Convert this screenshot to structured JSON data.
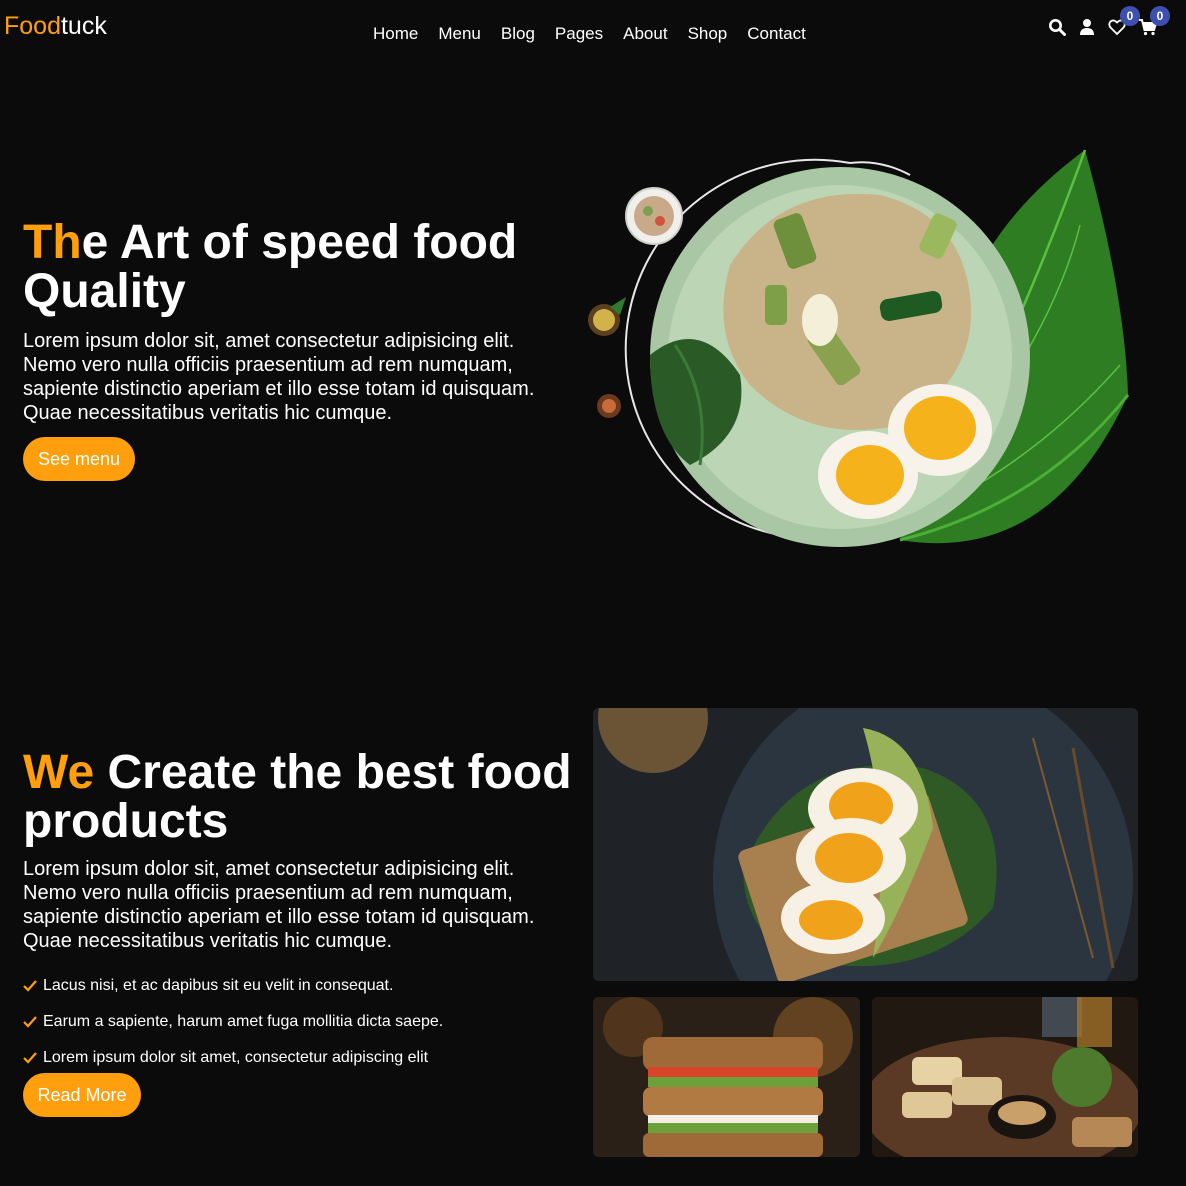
{
  "header": {
    "logo": {
      "part1": "Food",
      "part2": "tuck"
    },
    "nav": [
      "Home",
      "Menu",
      "Blog",
      "Pages",
      "About",
      "Shop",
      "Contact"
    ],
    "wishlist_count": "0",
    "cart_count": "0"
  },
  "hero": {
    "title_accent": "Th",
    "title_rest": "e Art of speed food Quality",
    "paragraph": "Lorem ipsum dolor sit, amet consectetur adipisicing elit. Nemo vero nulla officiis praesentium ad rem numquam, sapiente distinctio aperiam et illo esse totam id quisquam. Quae necessitatibus veritatis hic cumque.",
    "button": "See menu"
  },
  "about": {
    "title_accent": "We",
    "title_rest": " Create the best food products",
    "paragraph": "Lorem ipsum dolor sit, amet consectetur adipisicing elit. Nemo vero nulla officiis praesentium ad rem numquam, sapiente distinctio aperiam et illo esse totam id quisquam. Quae necessitatibus veritatis hic cumque.",
    "checklist": [
      "Lacus nisi, et ac dapibus sit eu velit in consequat.",
      "Earum a sapiente, harum amet fuga mollitia dicta saepe.",
      "Lorem ipsum dolor sit amet, consectetur adipiscing elit"
    ],
    "button": "Read More"
  },
  "colors": {
    "accent": "#ff9f0d",
    "background": "#0b0b0b",
    "badge": "#3f4fb0"
  }
}
